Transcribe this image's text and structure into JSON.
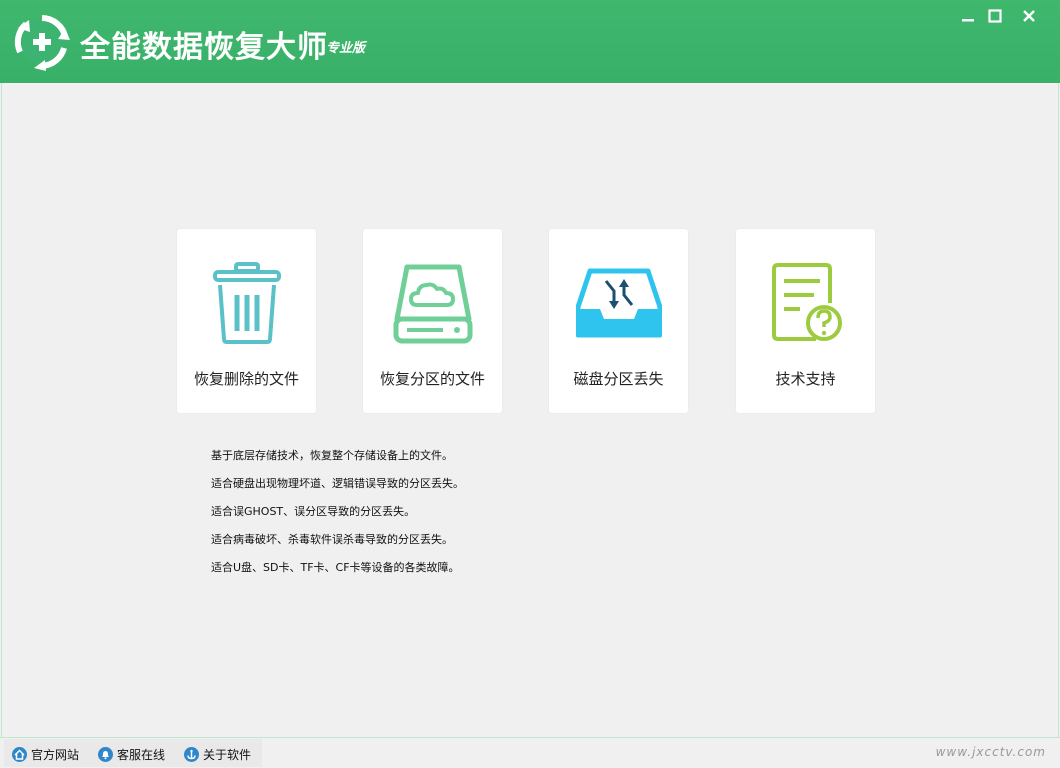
{
  "app": {
    "title": "全能数据恢复大师",
    "edition": "专业版"
  },
  "window_controls": {
    "minimize": "minimize",
    "maximize": "maximize",
    "close": "close"
  },
  "cards": [
    {
      "label": "恢复删除的文件",
      "icon": "trash-icon",
      "color": "#5bc1c8"
    },
    {
      "label": "恢复分区的文件",
      "icon": "cloud-drive-icon",
      "color": "#6fcf97"
    },
    {
      "label": "磁盘分区丢失",
      "icon": "inbox-swap-icon",
      "color": "#2ec4ee"
    },
    {
      "label": "技术支持",
      "icon": "document-question-icon",
      "color": "#9dcb3f"
    }
  ],
  "description": [
    "基于底层存储技术，恢复整个存储设备上的文件。",
    "适合硬盘出现物理坏道、逻辑错误导致的分区丢失。",
    "适合误GHOST、误分区导致的分区丢失。",
    "适合病毒破坏、杀毒软件误杀毒导致的分区丢失。",
    "适合U盘、SD卡、TF卡、CF卡等设备的各类故障。"
  ],
  "statusbar": {
    "links": [
      {
        "label": "官方网站",
        "icon": "home-icon"
      },
      {
        "label": "客服在线",
        "icon": "bell-icon"
      },
      {
        "label": "关于软件",
        "icon": "anchor-icon"
      }
    ],
    "watermark": "www.jxcctv.com"
  },
  "colors": {
    "titlebar": "#3cb371",
    "background": "#f0f0f0"
  }
}
